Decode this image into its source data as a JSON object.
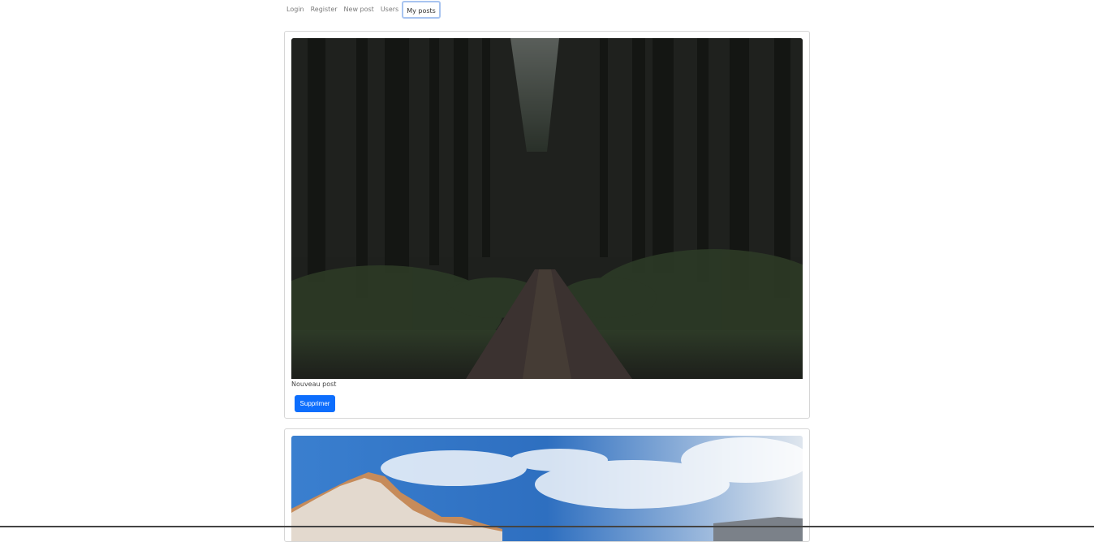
{
  "nav": {
    "items": [
      "Login",
      "Register",
      "New post",
      "Users",
      "My posts"
    ],
    "active": "My posts"
  },
  "posts": [
    {
      "image": "forest-path-image",
      "caption": "Nouveau post",
      "delete_label": "Supprimer"
    },
    {
      "image": "snowy-mountain-image"
    }
  ],
  "colors": {
    "primary": "#0d6efd",
    "focus_ring": "#a8c4f0",
    "border": "#d6d6d6"
  }
}
